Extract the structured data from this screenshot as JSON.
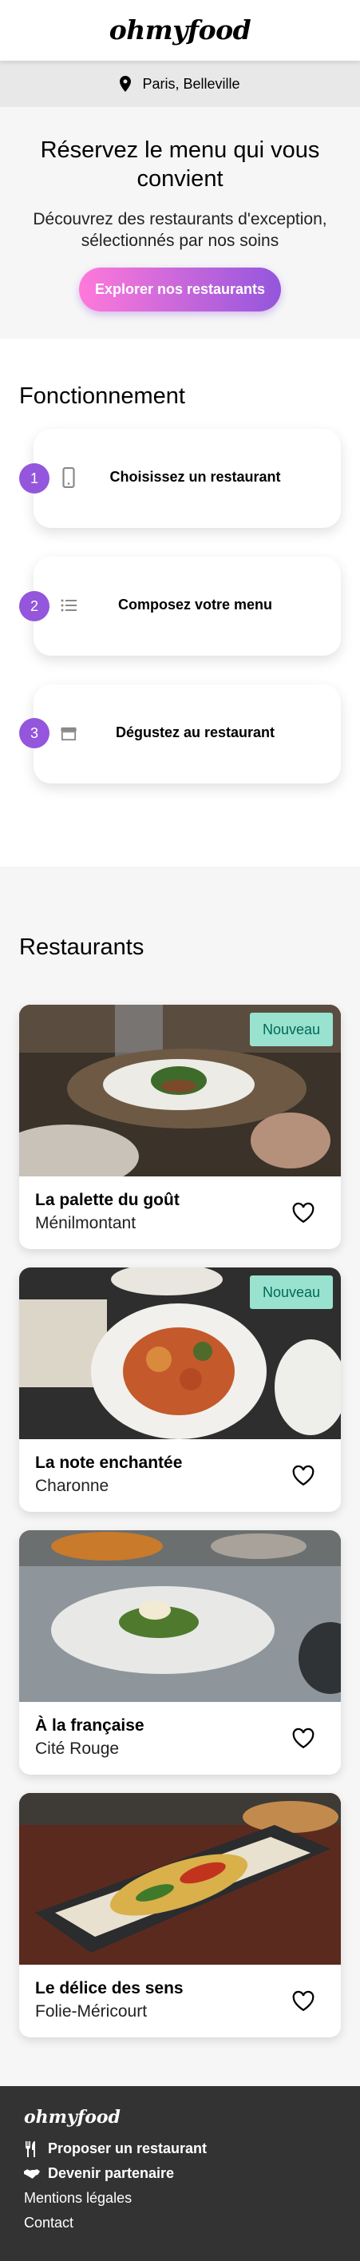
{
  "header": {
    "logo": "ohmyfood"
  },
  "location": {
    "icon": "map-marker-icon",
    "text": "Paris, Belleville"
  },
  "hero": {
    "title": "Réservez le menu qui vous convient",
    "subtitle": "Découvrez des restaurants d'exception, sélectionnés par nos soins",
    "button": "Explorer nos restaurants"
  },
  "how": {
    "title": "Fonctionnement",
    "steps": [
      {
        "number": "1",
        "icon": "mobile-phone-icon",
        "label": "Choisissez un restaurant"
      },
      {
        "number": "2",
        "icon": "list-icon",
        "label": "Composez votre menu"
      },
      {
        "number": "3",
        "icon": "storefront-icon",
        "label": "Dégustez au restaurant"
      }
    ]
  },
  "restaurants": {
    "title": "Restaurants",
    "items": [
      {
        "name": "La palette du goût",
        "location": "Ménilmontant",
        "badge": "Nouveau"
      },
      {
        "name": "La note enchantée",
        "location": "Charonne",
        "badge": "Nouveau"
      },
      {
        "name": "À la française",
        "location": "Cité Rouge",
        "badge": ""
      },
      {
        "name": "Le délice des sens",
        "location": "Folie-Méricourt",
        "badge": ""
      }
    ]
  },
  "footer": {
    "logo": "ohmyfood",
    "links": [
      {
        "icon": "utensils-icon",
        "label": "Proposer un restaurant"
      },
      {
        "icon": "handshake-icon",
        "label": "Devenir partenaire"
      },
      {
        "icon": "",
        "label": "Mentions légales"
      },
      {
        "icon": "",
        "label": "Contact"
      }
    ]
  },
  "colors": {
    "accent_purple": "#9356dc",
    "accent_pink": "#ff79da",
    "badge_bg": "#99e2d0",
    "badge_text": "#006a55",
    "footer_bg": "#333333"
  }
}
